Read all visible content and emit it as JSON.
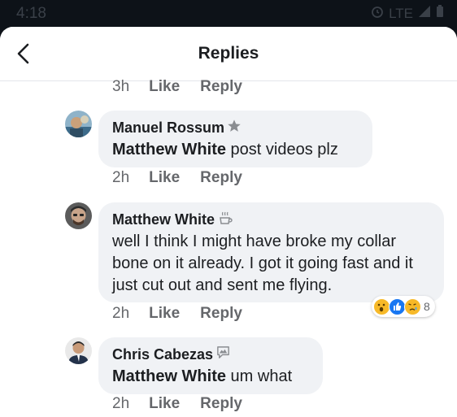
{
  "status_bar": {
    "time": "4:18",
    "network": "LTE"
  },
  "header": {
    "title": "Replies"
  },
  "comments": [
    {
      "time": "3h",
      "like": "Like",
      "reply": "Reply"
    },
    {
      "author": "Manuel Rossum",
      "mention": "Matthew White",
      "text": " post videos plz",
      "time": "2h",
      "like": "Like",
      "reply": "Reply",
      "badge_icon": "star-badge-icon"
    },
    {
      "author": "Matthew White",
      "text": "well I think I might have broke my collar bone on it already. I got it going fast and it just cut out and sent me flying.",
      "time": "2h",
      "like": "Like",
      "reply": "Reply",
      "badge_icon": "coffee-badge-icon",
      "reactions": {
        "count": "8",
        "types": [
          "wow",
          "like",
          "sad"
        ]
      }
    },
    {
      "author": "Chris Cabezas",
      "mention": "Matthew White",
      "text": " um what",
      "time": "2h",
      "like": "Like",
      "reply": "Reply",
      "badge_icon": "chat-badge-icon"
    }
  ],
  "colors": {
    "bubble": "#f0f2f5",
    "secondary_text": "#65676b",
    "like_blue": "#1877f2"
  }
}
